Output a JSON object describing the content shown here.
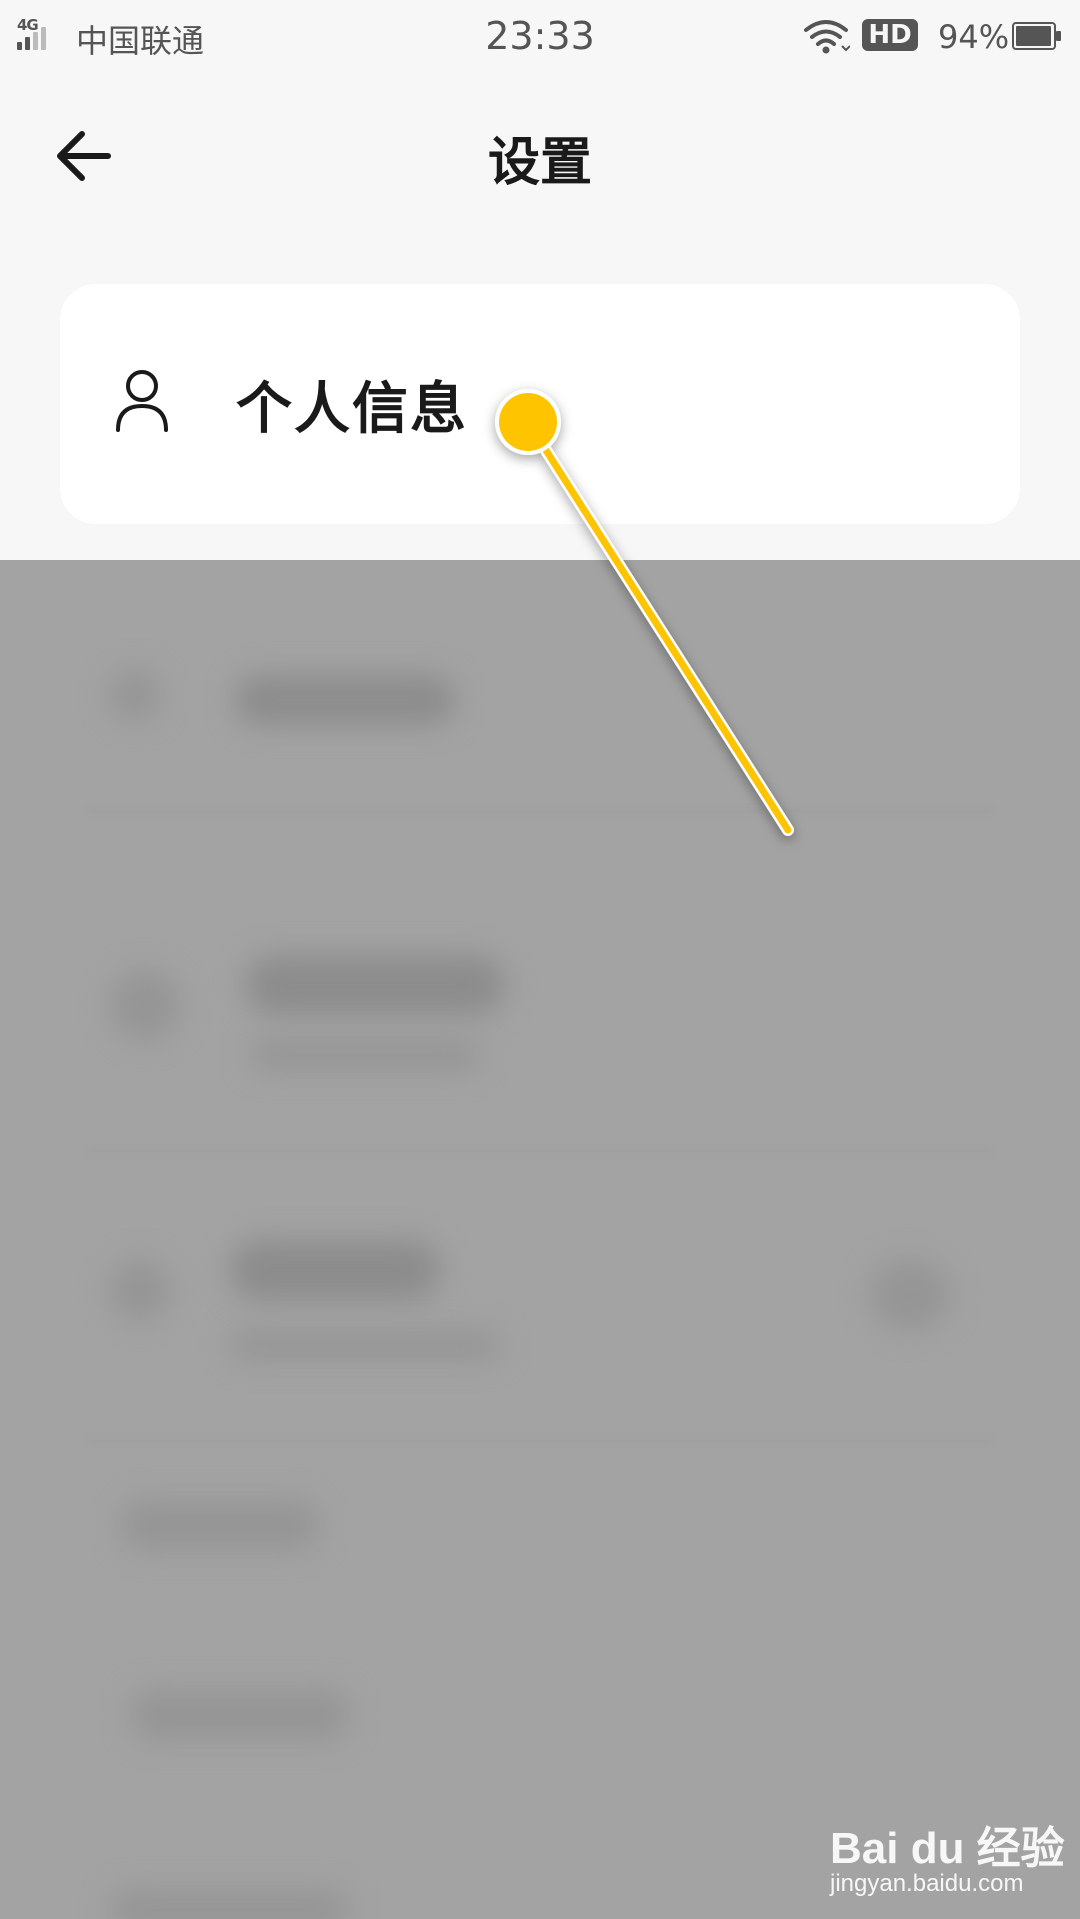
{
  "status_bar": {
    "network": "4G",
    "carrier": "中国联通",
    "time": "23:33",
    "hd": "HD",
    "battery": "94%"
  },
  "header": {
    "title": "设置"
  },
  "card": {
    "label": "个人信息"
  },
  "watermark": {
    "brand": "Bai du 经验",
    "url": "jingyan.baidu.com"
  },
  "colors": {
    "accent": "#ffc400",
    "overlay": "#a3a3a3",
    "background": "#f7f7f7"
  }
}
